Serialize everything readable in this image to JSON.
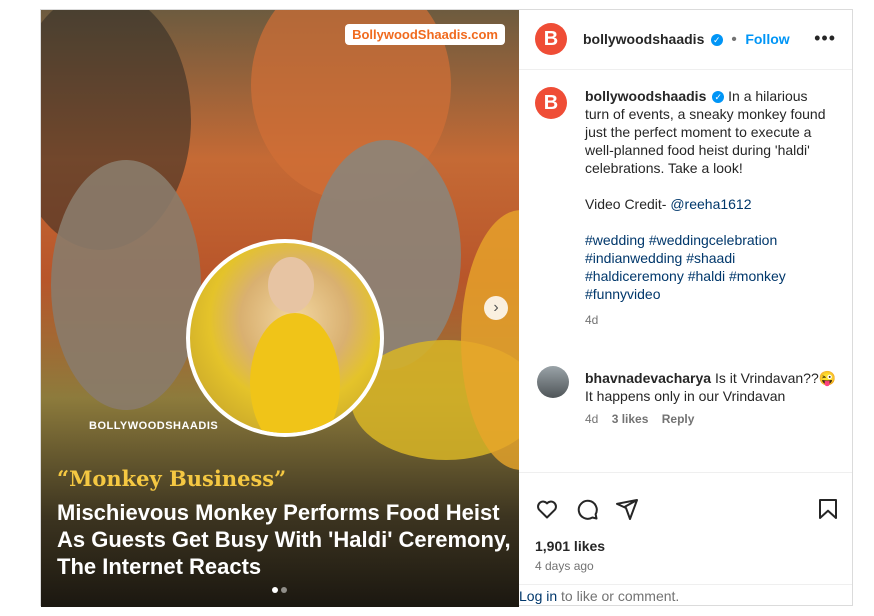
{
  "media": {
    "brand_badge": "BollywoodShaadis.com",
    "watermark": "BOLLYWOODSHAADIS",
    "quote": "“Monkey Business”",
    "headline": "Mischievous Monkey Performs Food Heist As Guests Get Busy With 'Haldi' Ceremony, The Internet Reacts",
    "next_icon": "›"
  },
  "header": {
    "avatar_letter": "B",
    "username": "bollywoodshaadis",
    "verified": "✓",
    "separator": "•",
    "follow_label": "Follow",
    "more_icon": "•••"
  },
  "caption": {
    "username": "bollywoodshaadis",
    "text": "In a hilarious turn of events, a sneaky monkey found just the perfect moment to execute a well-planned food heist during 'haldi' celebrations. Take a look!",
    "credit_label": "Video Credit-",
    "credit_handle": "@reeha1612",
    "hashtags": [
      "#wedding",
      "#weddingcelebration",
      "#indianwedding",
      "#shaadi",
      "#haldiceremony",
      "#haldi",
      "#monkey",
      "#funnyvideo"
    ],
    "age": "4d"
  },
  "comment": {
    "username": "bhavnadevacharya",
    "text": "Is it Vrindavan??😜 It happens only in our Vrindavan",
    "age": "4d",
    "likes": "3 likes",
    "reply_label": "Reply"
  },
  "footer": {
    "likes": "1,901 likes",
    "time_ago": "4 days ago",
    "login_link": "Log in",
    "login_text": " to like or comment."
  },
  "colors": {
    "accent": "#0095f6",
    "brand": "#ef4d36",
    "quote": "#f5c842"
  }
}
